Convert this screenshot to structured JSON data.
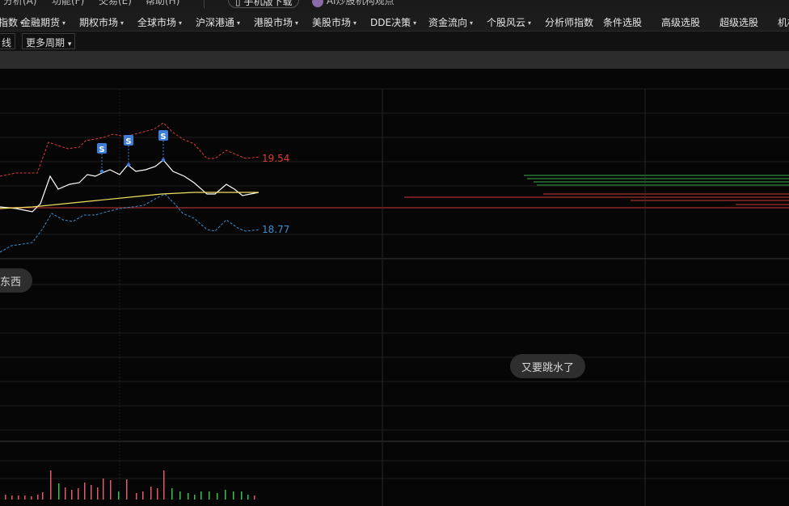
{
  "top_strip": {
    "items": [
      "分析(A)",
      "功能(F)",
      "交易(E)",
      "帮助(H)"
    ],
    "download_label": "手机版下载",
    "ai_label": "AI炒股机构观点"
  },
  "menu": {
    "items": [
      {
        "label": "指数",
        "caret": true
      },
      {
        "label": "金融期货",
        "caret": true
      },
      {
        "label": "期权市场",
        "caret": true
      },
      {
        "label": "全球市场",
        "caret": true
      },
      {
        "label": "沪深港通",
        "caret": true
      },
      {
        "label": "港股市场",
        "caret": true
      },
      {
        "label": "美股市场",
        "caret": true
      },
      {
        "label": "DDE决策",
        "caret": true
      },
      {
        "label": "资金流向",
        "caret": true
      },
      {
        "label": "个股风云",
        "caret": true
      },
      {
        "label": "分析师指数",
        "caret": false
      },
      {
        "label": "条件选股",
        "caret": false
      },
      {
        "label": "高级选股",
        "caret": false
      },
      {
        "label": "超级选股",
        "caret": false
      },
      {
        "label": "机构",
        "caret": false
      }
    ]
  },
  "period": {
    "line_label": "线",
    "more_label": "更多周期",
    "more_caret": "▾"
  },
  "chart": {
    "upper_label": "19.54",
    "lower_label": "18.77",
    "marker_letter": "S",
    "colors": {
      "upper_band": "#e03a3a",
      "lower_band": "#3a8fd0",
      "price_line": "#ffffff",
      "avg_line": "#f0e060",
      "grid": "#1e1e1e",
      "marker": "#3d7fd6",
      "vol_up": "#e05a6a",
      "vol_down": "#3cc050",
      "depth_buy": "#1f5a2a",
      "depth_sell": "#6a1f1f"
    }
  },
  "bubbles": {
    "left": "东西",
    "right": "又要跳水了"
  }
}
